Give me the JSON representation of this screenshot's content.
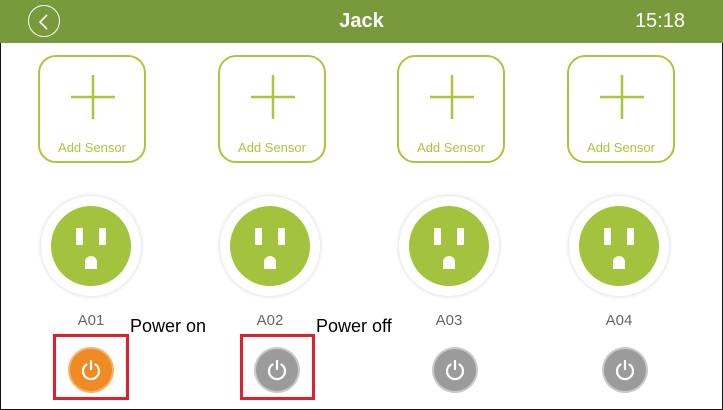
{
  "header": {
    "title": "Jack",
    "time": "15:18"
  },
  "sensors": [
    {
      "label": "Add  Sensor"
    },
    {
      "label": "Add  Sensor"
    },
    {
      "label": "Add  Sensor"
    },
    {
      "label": "Add  Sensor"
    }
  ],
  "outlets": [
    {
      "id": "A01",
      "power": "on"
    },
    {
      "id": "A02",
      "power": "off"
    },
    {
      "id": "A03",
      "power": "off"
    },
    {
      "id": "A04",
      "power": "off"
    }
  ],
  "annotations": {
    "power_on": "Power on",
    "power_off": "Power off"
  },
  "colors": {
    "header": "#789a3c",
    "accent": "#a9c63f",
    "power_on": "#f08a23",
    "power_off": "#9b9b9b",
    "highlight": "#e0212b"
  },
  "icons": {
    "back": "back-arrow-icon",
    "add": "plus-icon",
    "outlet": "power-outlet-icon",
    "power": "power-icon"
  }
}
